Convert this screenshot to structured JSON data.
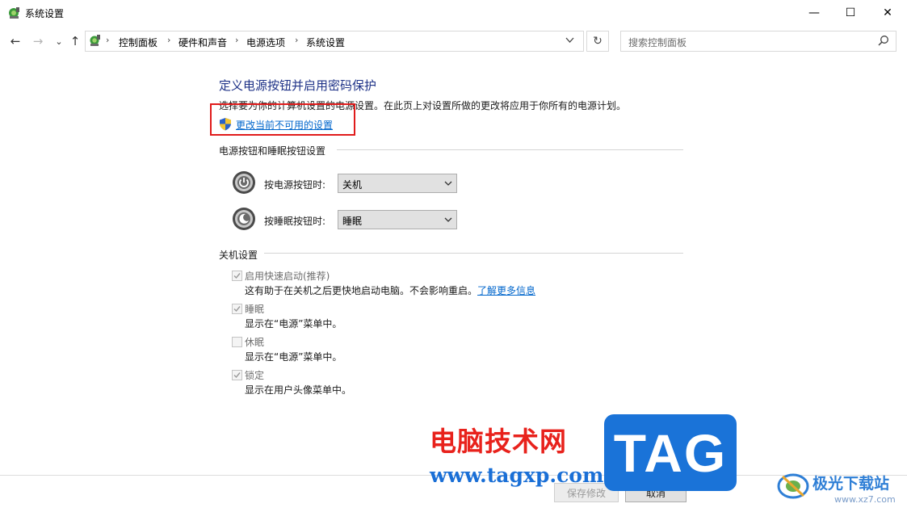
{
  "window": {
    "title": "系统设置",
    "minimize_glyph": "—",
    "maximize_glyph": "☐",
    "close_glyph": "✕"
  },
  "nav": {
    "back_glyph": "←",
    "forward_glyph": "→",
    "recent_glyph": "⌄",
    "up_glyph": "↑",
    "breadcrumbs": [
      "控制面板",
      "硬件和声音",
      "电源选项",
      "系统设置"
    ],
    "separator": "›",
    "refresh_glyph": "↻"
  },
  "search": {
    "placeholder": "搜索控制面板",
    "icon": "search-icon"
  },
  "content": {
    "heading": "定义电源按钮并启用密码保护",
    "description": "选择要为你的计算机设置的电源设置。在此页上对设置所做的更改将应用于你所有的电源计划。",
    "change_link": "更改当前不可用的设置",
    "shield_icon": "uac-shield-icon",
    "highlight_color": "#e01b1b"
  },
  "buttons_section": {
    "title": "电源按钮和睡眠按钮设置",
    "rows": [
      {
        "label": "按电源按钮时:",
        "value": "关机",
        "icon": "power-button-icon"
      },
      {
        "label": "按睡眠按钮时:",
        "value": "睡眠",
        "icon": "sleep-button-icon"
      }
    ]
  },
  "shutdown_section": {
    "title": "关机设置",
    "options": [
      {
        "label": "启用快速启动(推荐)",
        "checked": true,
        "desc": "这有助于在关机之后更快地启动电脑。不会影响重启。",
        "link": "了解更多信息"
      },
      {
        "label": "睡眠",
        "checked": true,
        "desc": "显示在“电源”菜单中。"
      },
      {
        "label": "休眠",
        "checked": false,
        "desc": "显示在“电源”菜单中。"
      },
      {
        "label": "锁定",
        "checked": true,
        "desc": "显示在用户头像菜单中。"
      }
    ]
  },
  "footer": {
    "save_label": "保存修改",
    "cancel_label": "取消"
  },
  "watermark": {
    "cn_text": "电脑技术网",
    "url": "www.tagxp.com",
    "tag": "TAG",
    "logo_text": "极光下载站",
    "logo_url": "www.xz7.com"
  },
  "colors": {
    "heading": "#1e3287",
    "link": "#0066cc",
    "watermark_red": "#e8221c",
    "watermark_blue": "#1a73d8"
  }
}
